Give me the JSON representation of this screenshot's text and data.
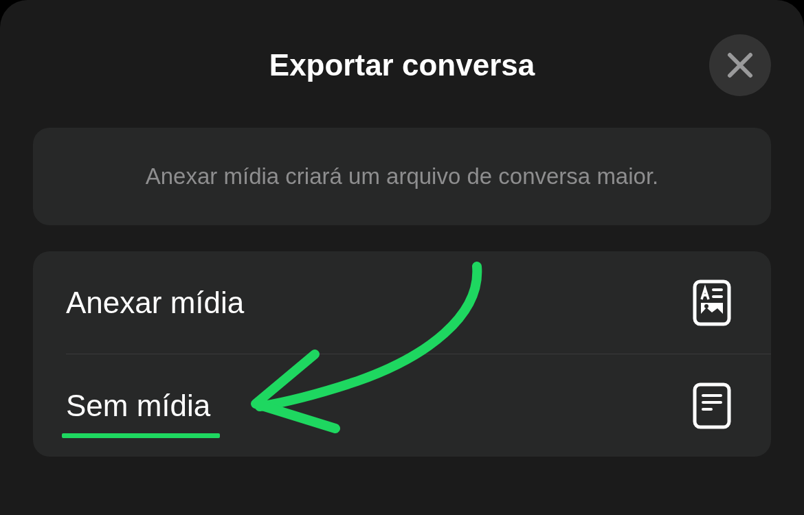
{
  "sheet": {
    "title": "Exportar conversa"
  },
  "info": "Anexar mídia criará um arquivo de conversa maior.",
  "options": [
    {
      "label": "Anexar mídia",
      "kind": "media",
      "highlighted": false
    },
    {
      "label": "Sem mídia",
      "kind": "text",
      "highlighted": true
    }
  ]
}
